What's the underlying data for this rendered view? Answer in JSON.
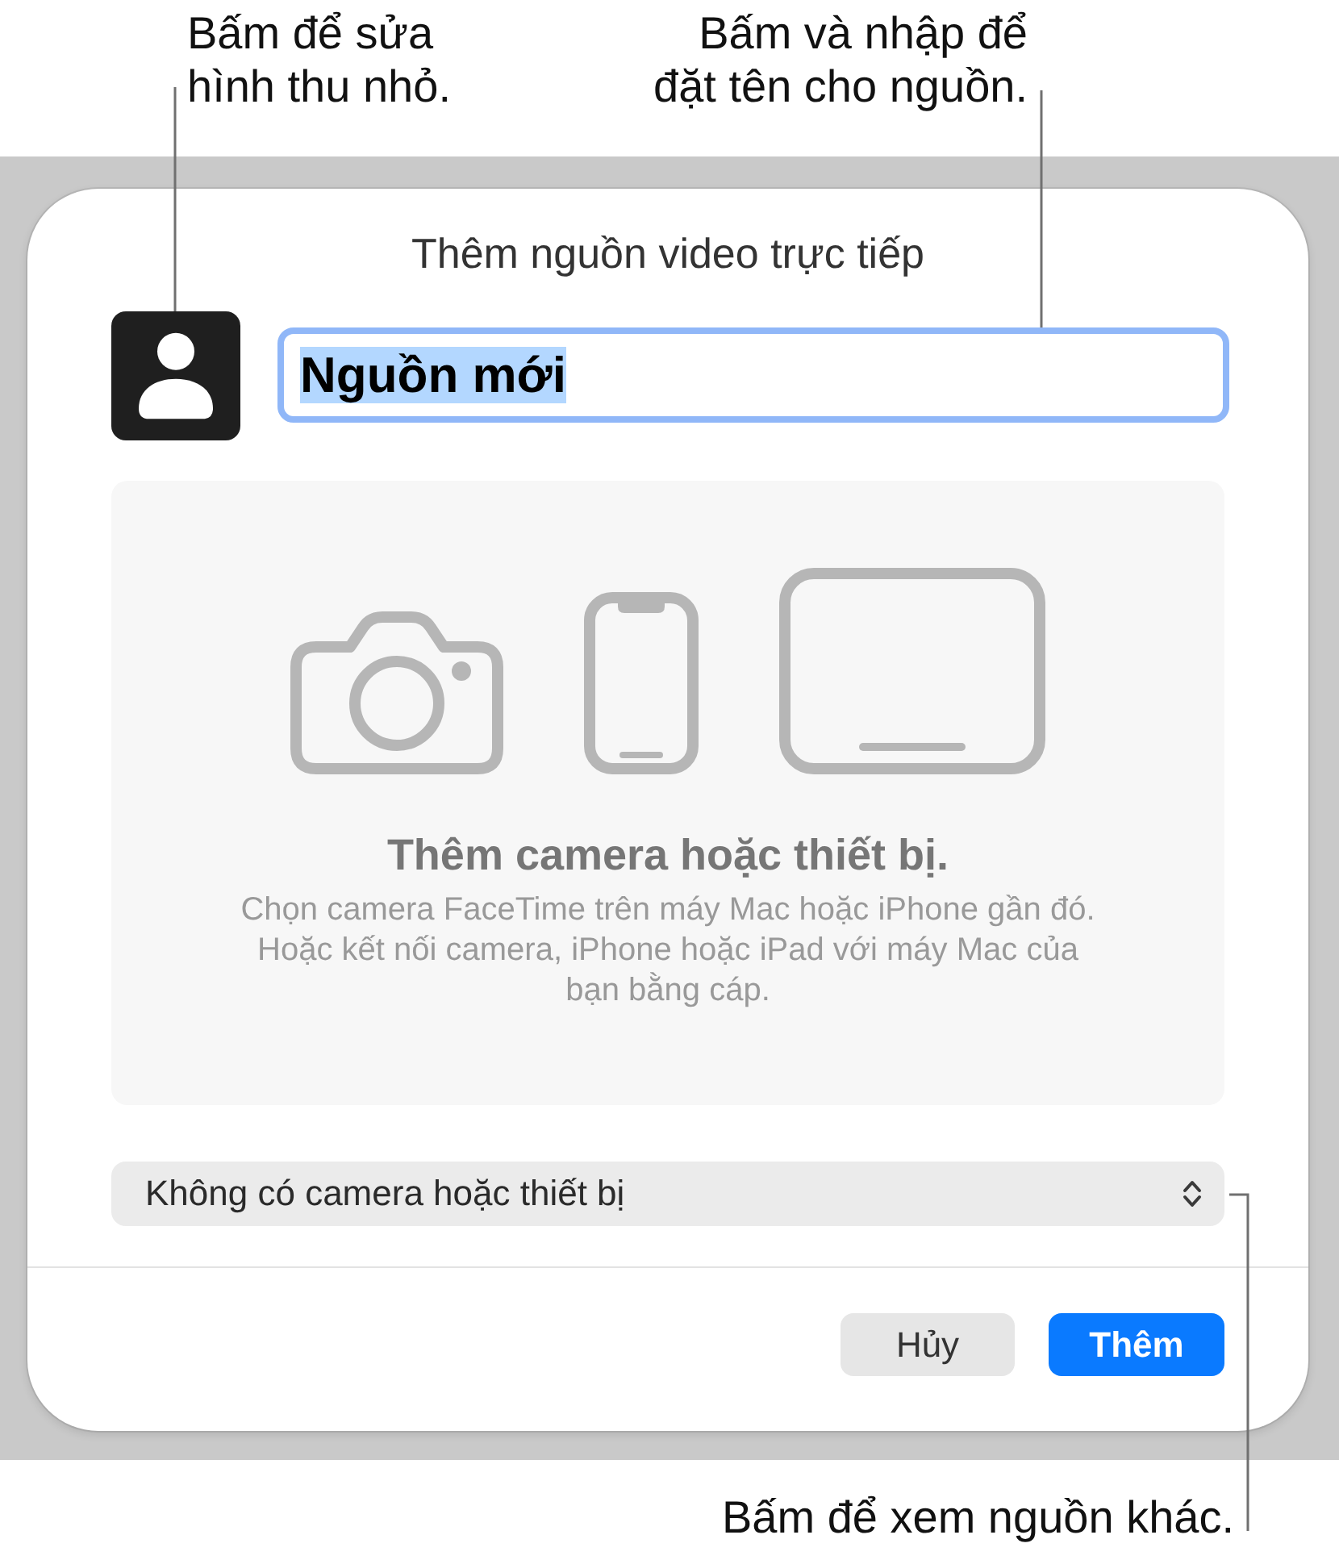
{
  "callouts": {
    "thumbnail": "Bấm để sửa\nhình thu nhỏ.",
    "name": "Bấm và nhập để\nđặt tên cho nguồn.",
    "source": "Bấm để xem nguồn khác."
  },
  "dialog": {
    "title": "Thêm nguồn video trực tiếp",
    "name_field": {
      "value": "Nguồn mới",
      "focused": true,
      "text_selected": true
    },
    "empty_state": {
      "heading": "Thêm camera hoặc thiết bị.",
      "text": "Chọn camera FaceTime trên máy Mac hoặc iPhone gần đó.\nHoặc kết nối camera, iPhone hoặc iPad với máy Mac của\nbạn bằng cáp."
    },
    "source_popup": {
      "value": "Không có camera hoặc thiết bị"
    },
    "buttons": [
      {
        "label": "Hủy",
        "kind": "cancel"
      },
      {
        "label": "Thêm",
        "kind": "default"
      }
    ]
  }
}
